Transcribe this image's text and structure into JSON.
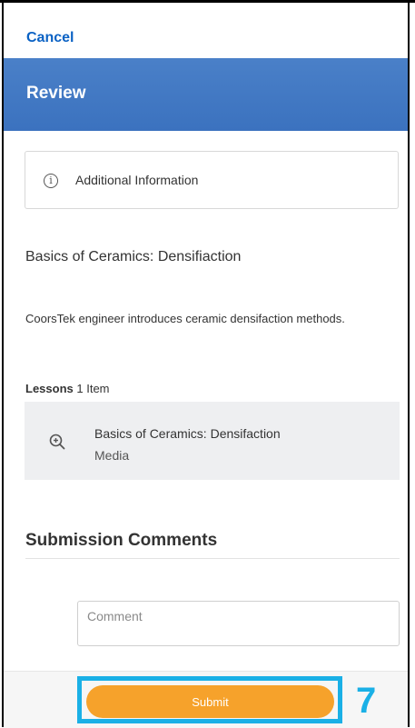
{
  "nav": {
    "cancel_label": "Cancel"
  },
  "header": {
    "title": "Review"
  },
  "info_card": {
    "icon": "info-icon",
    "text": "Additional Information"
  },
  "course": {
    "title": "Basics of Ceramics: Densifiaction",
    "description": "CoorsTek engineer introduces ceramic densifaction methods."
  },
  "lessons": {
    "label": "Lessons",
    "count": "1 Item",
    "items": [
      {
        "icon": "zoom-in-icon",
        "title": "Basics of Ceramics: Densifaction",
        "type": "Media"
      }
    ]
  },
  "submission": {
    "heading": "Submission Comments",
    "comment_placeholder": "Comment",
    "comment_value": ""
  },
  "footer": {
    "submit_label": "Submit"
  },
  "annotation": {
    "step_number": "7"
  },
  "colors": {
    "header_blue": "#3b72bf",
    "link_blue": "#0b62c4",
    "submit_orange": "#f6a22b",
    "highlight_cyan": "#1ab0e6"
  }
}
